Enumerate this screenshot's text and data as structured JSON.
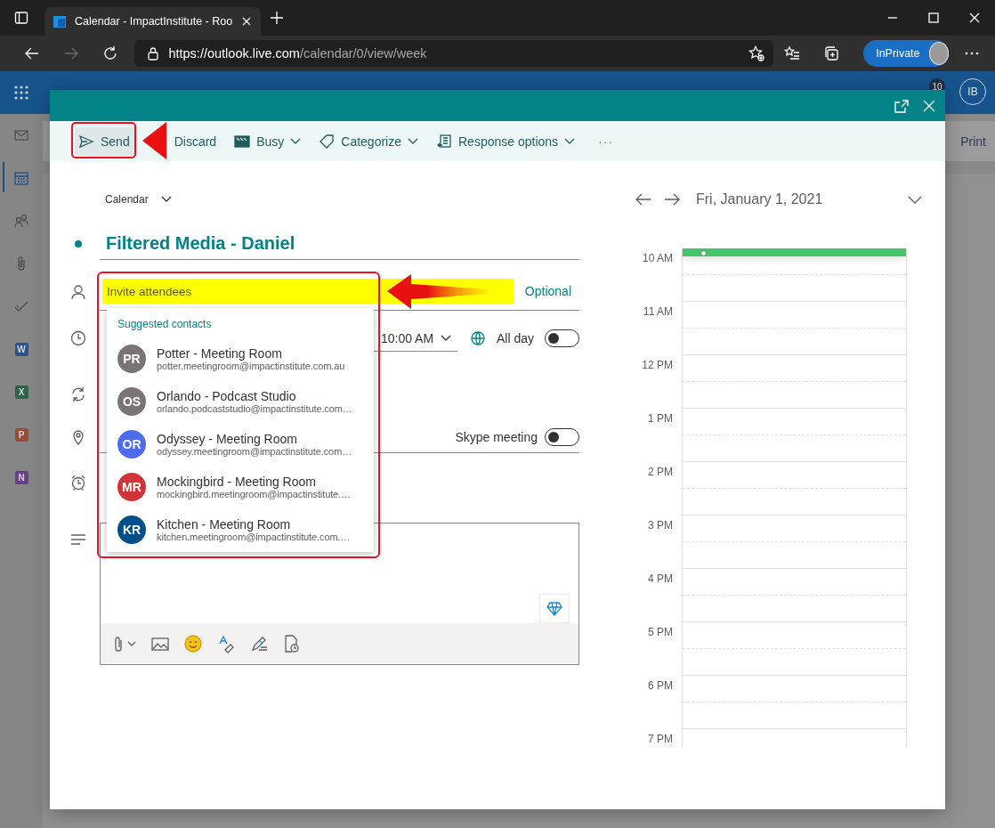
{
  "browser": {
    "tab_title": "Calendar - ImpactInstitute - Roo",
    "url": {
      "host": "https://outlook.live.com",
      "path": "/calendar/0/view/week"
    },
    "profile_label": "InPrivate"
  },
  "app_header": {
    "notification_count": "10",
    "account_initials": "IB"
  },
  "nav_rail": [
    {
      "kind": "mail",
      "selected": false
    },
    {
      "kind": "calendar",
      "selected": true
    },
    {
      "kind": "people",
      "selected": false
    },
    {
      "kind": "files",
      "selected": false
    },
    {
      "kind": "todo",
      "selected": false
    },
    {
      "kind": "app",
      "label": "W",
      "color": "#2d528c",
      "selected": false
    },
    {
      "kind": "app",
      "label": "X",
      "color": "#2e6446",
      "selected": false
    },
    {
      "kind": "app",
      "label": "P",
      "color": "#9c4a36",
      "selected": false
    },
    {
      "kind": "app",
      "label": "N",
      "color": "#6a3d88",
      "selected": false
    }
  ],
  "background_toolbar": {
    "print": "Print"
  },
  "dialog": {
    "toolbar": [
      {
        "label": "Send",
        "has_menu": false
      },
      {
        "label": "Discard",
        "has_menu": false
      },
      {
        "label": "Busy",
        "has_menu": true
      },
      {
        "label": "Categorize",
        "has_menu": true
      },
      {
        "label": "Response options",
        "has_menu": true
      }
    ],
    "more": "···",
    "calendar_picker": "Calendar",
    "title": "Filtered Media - Daniel",
    "attendees": {
      "placeholder": "Invite attendees",
      "optional_link": "Optional"
    },
    "start_time": "10:00 AM",
    "all_day": {
      "label": "All day",
      "on": false
    },
    "skype": {
      "label": "Skype meeting",
      "on": false
    },
    "suggestions": {
      "heading": "Suggested contacts",
      "contacts": [
        {
          "initials": "PR",
          "name": "Potter - Meeting Room",
          "email": "potter.meetingroom@impactinstitute.com.au",
          "color": "#7a7574"
        },
        {
          "initials": "OS",
          "name": "Orlando - Podcast Studio",
          "email": "orlando.podcaststudio@impactinstitute.com…",
          "color": "#7a7574"
        },
        {
          "initials": "OR",
          "name": "Odyssey - Meeting Room",
          "email": "odyssey.meetingroom@impactinstitute.com…",
          "color": "#4f6bed"
        },
        {
          "initials": "MR",
          "name": "Mockingbird - Meeting Room",
          "email": "mockingbird.meetingroom@impactinstitute.…",
          "color": "#d13438"
        },
        {
          "initials": "KR",
          "name": "Kitchen - Meeting Room",
          "email": "kitchen.meetingroom@impactinstitute.com.…",
          "color": "#004e8c"
        }
      ]
    },
    "day_view": {
      "date": "Fri, January 1, 2021",
      "hours": [
        "10 AM",
        "11 AM",
        "12 PM",
        "1 PM",
        "2 PM",
        "3 PM",
        "4 PM",
        "5 PM",
        "6 PM",
        "7 PM"
      ]
    }
  }
}
